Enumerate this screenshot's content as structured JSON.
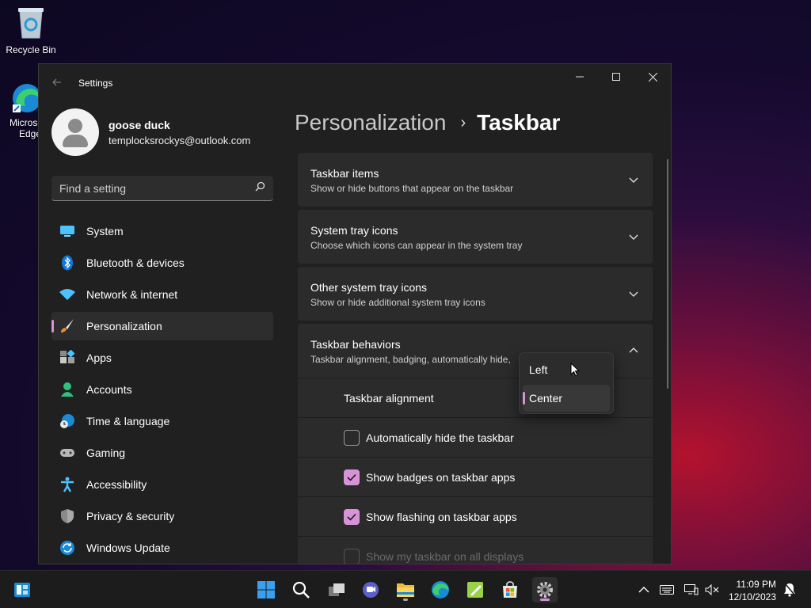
{
  "desktop": {
    "recycle_bin_label": "Recycle Bin",
    "edge_label_line1": "Micros",
    "edge_label_line2": "Edge"
  },
  "window": {
    "title": "Settings"
  },
  "profile": {
    "name": "goose duck",
    "email": "templocksrockys@outlook.com"
  },
  "search": {
    "placeholder": "Find a setting"
  },
  "nav": {
    "items": [
      {
        "label": "System",
        "icon": "system-icon"
      },
      {
        "label": "Bluetooth & devices",
        "icon": "bluetooth-icon"
      },
      {
        "label": "Network & internet",
        "icon": "wifi-icon"
      },
      {
        "label": "Personalization",
        "icon": "brush-icon",
        "selected": true
      },
      {
        "label": "Apps",
        "icon": "apps-icon"
      },
      {
        "label": "Accounts",
        "icon": "accounts-icon"
      },
      {
        "label": "Time & language",
        "icon": "globe-clock-icon"
      },
      {
        "label": "Gaming",
        "icon": "gamepad-icon"
      },
      {
        "label": "Accessibility",
        "icon": "accessibility-icon"
      },
      {
        "label": "Privacy & security",
        "icon": "shield-icon"
      },
      {
        "label": "Windows Update",
        "icon": "update-icon"
      }
    ]
  },
  "breadcrumb": {
    "parent": "Personalization",
    "separator": "›",
    "current": "Taskbar"
  },
  "sections": [
    {
      "title": "Taskbar items",
      "subtitle": "Show or hide buttons that appear on the taskbar"
    },
    {
      "title": "System tray icons",
      "subtitle": "Choose which icons can appear in the system tray"
    },
    {
      "title": "Other system tray icons",
      "subtitle": "Show or hide additional system tray icons"
    },
    {
      "title": "Taskbar behaviors",
      "subtitle": "Taskbar alignment, badging, automatically hide,"
    }
  ],
  "behaviors": {
    "alignment_label": "Taskbar alignment",
    "auto_hide_label": "Automatically hide the taskbar",
    "auto_hide_checked": false,
    "badges_label": "Show badges on taskbar apps",
    "badges_checked": true,
    "flashing_label": "Show flashing on taskbar apps",
    "flashing_checked": true,
    "all_displays_label": "Show my taskbar on all displays",
    "all_displays_checked": false
  },
  "alignment_dropdown": {
    "options": [
      "Left",
      "Center"
    ],
    "selected": "Center"
  },
  "taskbar": {
    "time": "11:09 PM",
    "date": "12/10/2023"
  },
  "colors": {
    "accent": "#d694d6",
    "window_bg": "#202020",
    "card_bg": "#2b2b2b"
  }
}
